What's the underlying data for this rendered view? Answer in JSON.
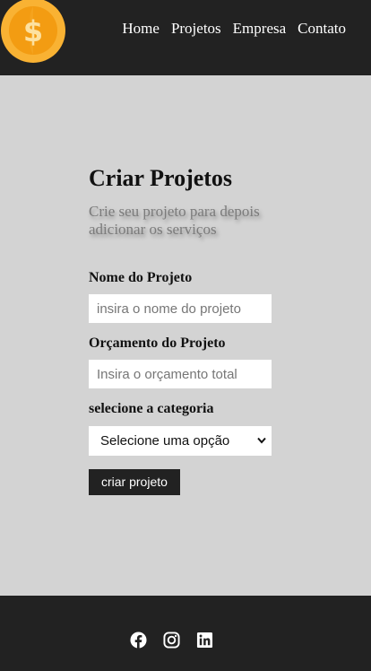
{
  "header": {
    "logo_icon": "coin-dollar-icon",
    "nav": [
      "Home",
      "Projetos",
      "Empresa",
      "Contato"
    ]
  },
  "main": {
    "title": "Criar Projetos",
    "subtitle": "Crie seu projeto para depois adicionar os serviços",
    "form": {
      "name_label": "Nome do Projeto",
      "name_placeholder": "insira o nome do projeto",
      "name_value": "",
      "budget_label": "Orçamento do Projeto",
      "budget_placeholder": "Insira o orçamento total",
      "budget_value": "",
      "category_label": "selecione a categoria",
      "category_selected": "Selecione uma opção",
      "submit_label": "criar projeto"
    }
  },
  "footer": {
    "social": [
      "facebook-icon",
      "instagram-icon",
      "linkedin-icon"
    ]
  },
  "colors": {
    "bar_background": "#222222",
    "page_background": "#d3d3d3",
    "coin_outer": "#f9b233",
    "coin_inner": "#f39c12"
  }
}
